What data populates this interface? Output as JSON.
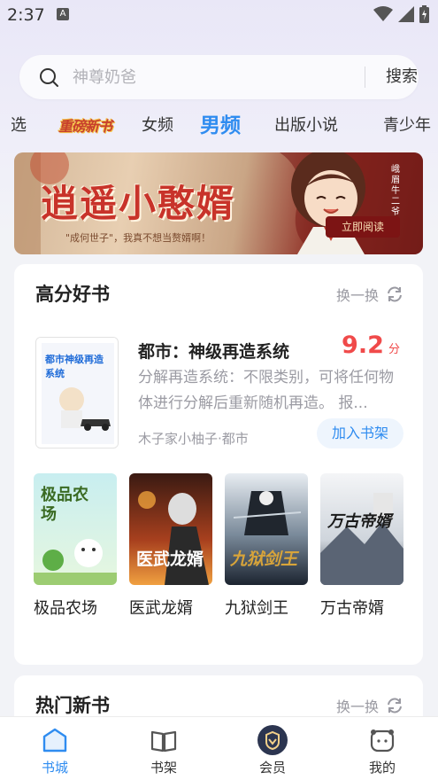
{
  "status": {
    "time": "2:37",
    "a_badge": "A"
  },
  "search": {
    "placeholder": "神尊奶爸",
    "button": "搜索"
  },
  "tabs": [
    {
      "label": "选"
    },
    {
      "label": "重磅新书"
    },
    {
      "label": "女频"
    },
    {
      "label": "男频",
      "active": true
    },
    {
      "label": "出版小说"
    },
    {
      "label": "青少年"
    }
  ],
  "banner": {
    "title": "逍遥小憨婿",
    "subtitle": "\"成何世子\"，我真不想当赘婿啊！",
    "read_button": "立即阅读",
    "author": "峨眉牛二爷"
  },
  "high_score": {
    "title": "高分好书",
    "refresh": "换一换",
    "featured": {
      "title": "都市：神级再造系统",
      "score": "9.2",
      "score_unit": "分",
      "description": "分解再造系统：不限类别，可将任何物体进行分解后重新随机再造。 报...",
      "meta": "木子家小柚子·都市",
      "add_button": "加入书架",
      "cover_text": "都市神级再造系统"
    },
    "books": [
      {
        "title": "极品农场",
        "cover_text": "极品农场"
      },
      {
        "title": "医武龙婿",
        "cover_text": "医武龙婿"
      },
      {
        "title": "九狱剑王",
        "cover_text": "九狱剑王"
      },
      {
        "title": "万古帝婿",
        "cover_text": "万古帝婿"
      }
    ]
  },
  "hot_new": {
    "title": "热门新书",
    "refresh": "换一换"
  },
  "nav": [
    {
      "label": "书城",
      "icon": "bookstore-icon",
      "active": true
    },
    {
      "label": "书架",
      "icon": "bookshelf-icon"
    },
    {
      "label": "会员",
      "icon": "vip-icon"
    },
    {
      "label": "我的",
      "icon": "profile-icon"
    }
  ],
  "colors": {
    "accent": "#2f8cf0",
    "score": "#f04a4a"
  }
}
